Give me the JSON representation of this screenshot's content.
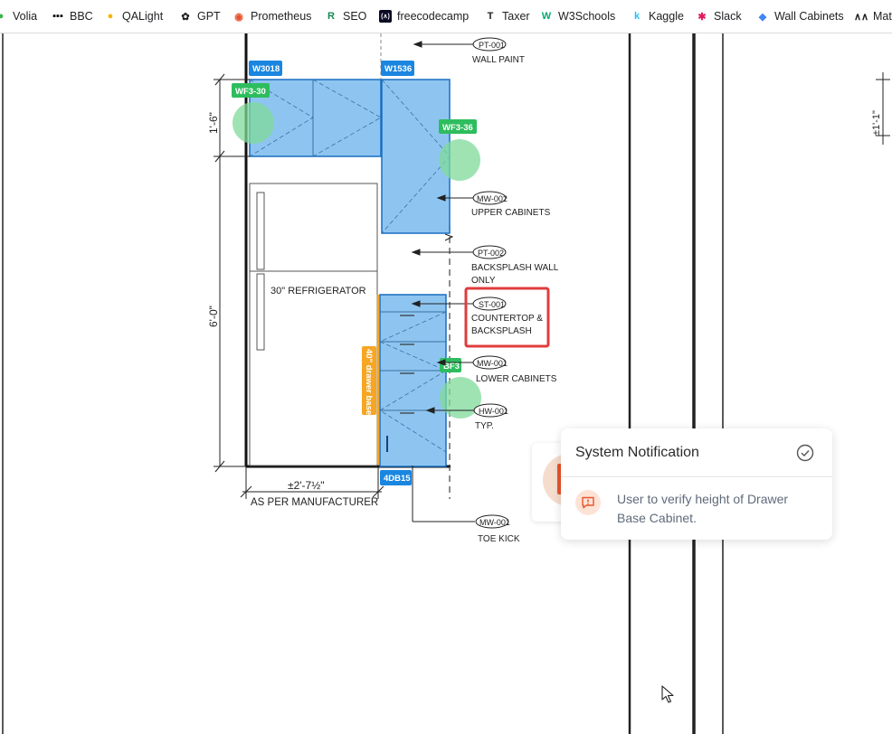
{
  "bookmarks": [
    {
      "label": "Volia",
      "icon": "volia-icon",
      "color": "#3cb34a"
    },
    {
      "label": "BBC",
      "icon": "bbc-icon",
      "color": "#000000"
    },
    {
      "label": "QALight",
      "icon": "qalight-icon",
      "color": "#f5b400"
    },
    {
      "label": "GPT",
      "icon": "openai-icon",
      "color": "#202124"
    },
    {
      "label": "Prometheus",
      "icon": "prometheus-icon",
      "color": "#e6522c"
    },
    {
      "label": "SEO",
      "icon": "seo-icon",
      "color": "#138a52"
    },
    {
      "label": "freecodecamp",
      "icon": "freecodecamp-icon",
      "color": "#0a0a23"
    },
    {
      "label": "Taxer",
      "icon": "taxer-icon",
      "color": "#202124"
    },
    {
      "label": "W3Schools",
      "icon": "w3schools-icon",
      "color": "#04aa6d"
    },
    {
      "label": "Kaggle",
      "icon": "kaggle-icon",
      "color": "#20beff"
    },
    {
      "label": "Slack",
      "icon": "slack-icon",
      "color": "#e01e5a"
    },
    {
      "label": "Wall Cabinets",
      "icon": "cube-icon",
      "color": "#4285f4"
    },
    {
      "label": "Mat",
      "icon": "mat-icon",
      "color": "#202124"
    }
  ],
  "drawing": {
    "tags": {
      "w3018": "W3018",
      "w1536": "W1536",
      "wf3_30": "WF3-30",
      "wf3_36": "WF3-36",
      "bf3": "BF3",
      "d4db15": "4DB15",
      "drawer_base": "40\" drawer base"
    },
    "callouts": {
      "pt001": {
        "code": "PT-001",
        "line1": "WALL PAINT",
        "line2": ""
      },
      "mw002": {
        "code": "MW-002",
        "line1": "UPPER CABINETS",
        "line2": ""
      },
      "pt002": {
        "code": "PT-002",
        "line1": "BACKSPLASH WALL",
        "line2": "ONLY"
      },
      "st001": {
        "code": "ST-001",
        "line1": "COUNTERTOP &",
        "line2": "BACKSPLASH"
      },
      "mw001": {
        "code": "MW-001",
        "line1": "LOWER CABINETS",
        "line2": ""
      },
      "hw001": {
        "code": "HW-001",
        "line1": "TYP.",
        "line2": ""
      },
      "mw001b": {
        "code": "MW-001",
        "line1": "TOE KICK",
        "line2": ""
      }
    },
    "refrigerator_label": "30\" REFRIGERATOR",
    "dims": {
      "upper": "1'-6\"",
      "height": "6'-0\"",
      "width": "±2'-7½\"",
      "manufacturer": "AS PER MANUFACTURER",
      "right": "±1'-1\""
    },
    "colors": {
      "cabinet": "#7fbfef",
      "tag_blue": "#1a86e0",
      "tag_green": "#2ebd5e",
      "marker_green": "#7fd99a",
      "drawer_orange": "#f6a623",
      "highlight_red": "#e03c3c"
    }
  },
  "notification": {
    "title": "System Notification",
    "message": "User to verify height of Drawer Base Cabinet."
  }
}
